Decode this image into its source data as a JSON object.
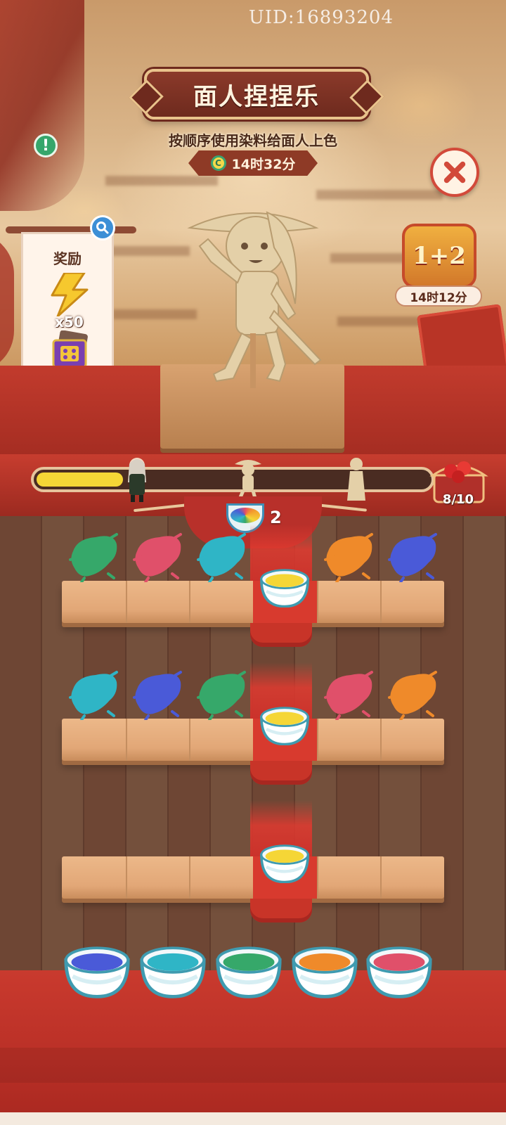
{
  "header": {
    "uid": "UID:16893204",
    "title": "面人捏捏乐",
    "subtitle": "按顺序使用染料给面人上色",
    "timer": "14时32分"
  },
  "reward": {
    "title": "奖励",
    "quantity": "x50"
  },
  "event": {
    "label": "1+2",
    "timer": "14时12分"
  },
  "progress": {
    "fraction": 0.22,
    "chest_count": "8/10"
  },
  "mix": {
    "count": "2"
  },
  "colors": {
    "green": "#36a86a",
    "pink": "#e0506a",
    "cyan": "#2fb5c6",
    "orange": "#ef8a2a",
    "blue": "#4a5ad8",
    "yellow": "#f5d636"
  },
  "rows": [
    {
      "splashes": [
        "green",
        "pink",
        "cyan",
        null,
        "orange",
        "blue"
      ],
      "target": "yellow"
    },
    {
      "splashes": [
        "cyan",
        "blue",
        "green",
        null,
        "pink",
        "orange"
      ],
      "target": "yellow"
    },
    {
      "splashes": [
        null,
        null,
        null,
        null,
        null,
        null
      ],
      "target": "yellow"
    }
  ],
  "palette": [
    "blue",
    "cyan",
    "green",
    "orange",
    "pink"
  ]
}
